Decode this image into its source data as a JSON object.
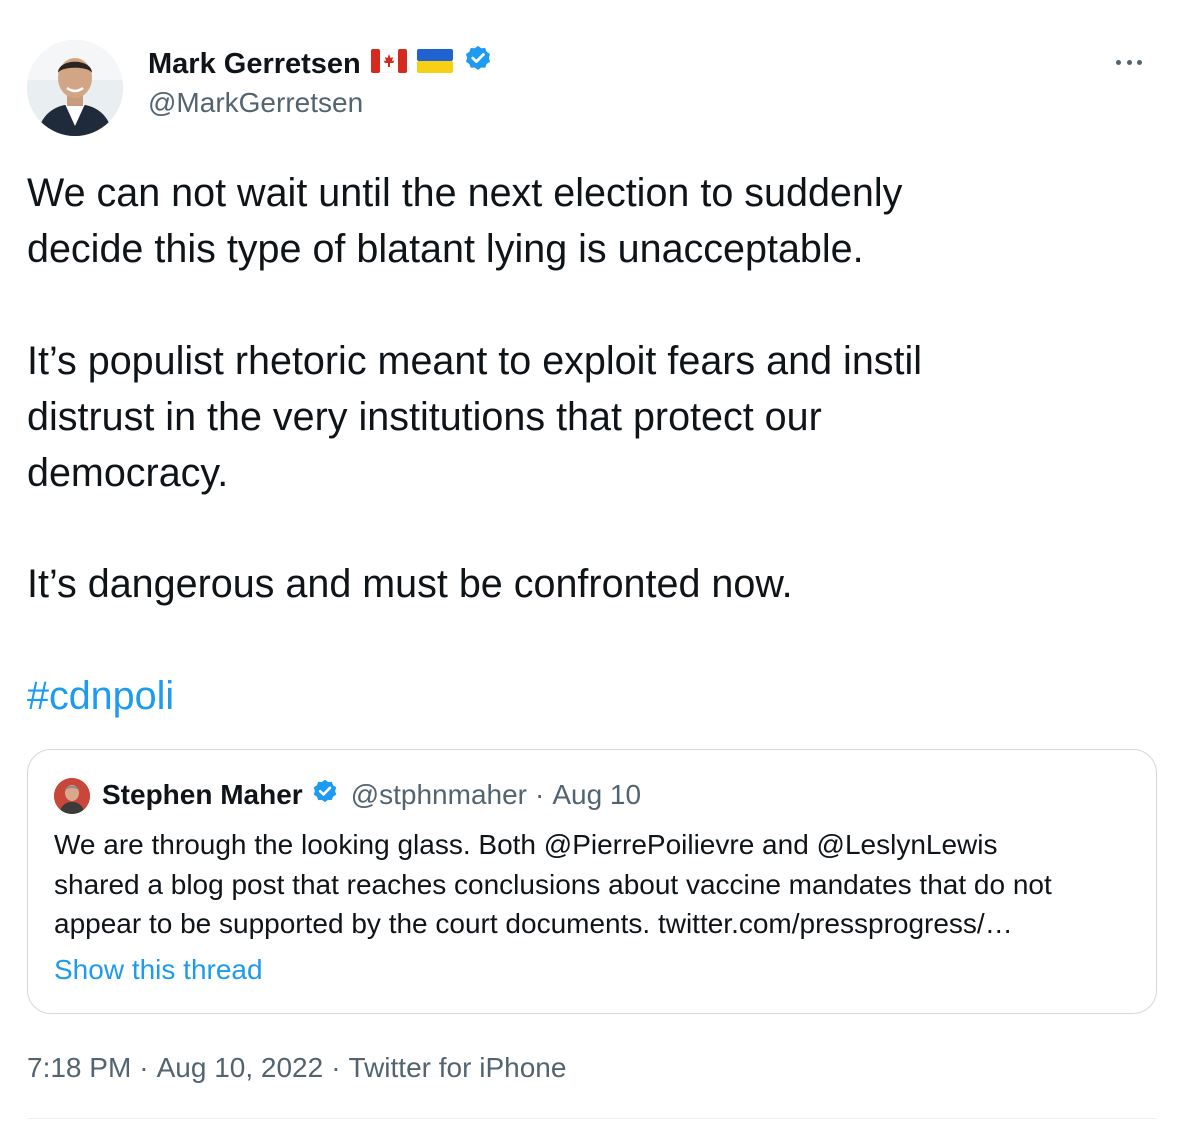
{
  "author": {
    "name": "Mark Gerretsen",
    "handle": "@MarkGerretsen",
    "flags": [
      "canada-flag",
      "ukraine-flag"
    ],
    "verified": true
  },
  "tweet": {
    "line1": "We can not wait until the next election to suddenly",
    "line2": "decide this type of blatant lying is unacceptable.",
    "line3": "It’s populist rhetoric meant to exploit fears and instil",
    "line4": "distrust in the very institutions that protect our",
    "line5": "democracy.",
    "line6": "It’s dangerous and must be confronted now.",
    "hashtag": "#cdnpoli"
  },
  "quote": {
    "name": "Stephen Maher",
    "handle": "@stphnmaher",
    "separator": "·",
    "date": "Aug 10",
    "line1": "We are through the looking glass. Both @PierrePoilievre and @LeslynLewis",
    "line2": "shared a blog post that reaches conclusions about vaccine mandates that do not",
    "line3": "appear to be supported by the court documents. twitter.com/pressprogress/…",
    "show_thread": "Show this thread"
  },
  "meta": {
    "time": "7:18 PM",
    "sep": "·",
    "date": "Aug 10, 2022",
    "source": "Twitter for iPhone"
  },
  "colors": {
    "accent": "#1d9bf0",
    "secondary_text": "#536471",
    "border": "#cfd9de"
  }
}
